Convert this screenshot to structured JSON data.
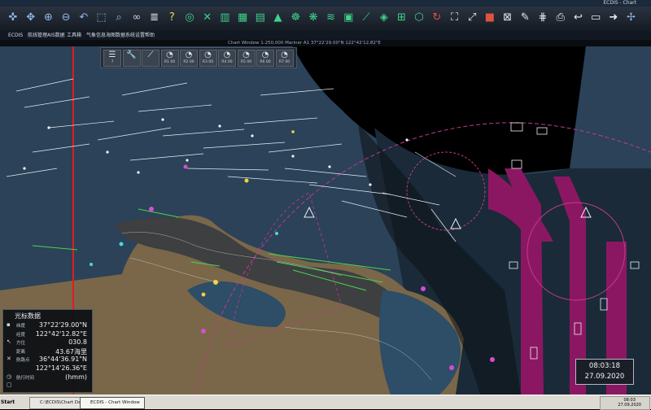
{
  "window": {
    "title": "ECDIS - Chart"
  },
  "toolbar": {
    "buttons": [
      {
        "name": "cursor-tool-button",
        "icon": "crosshair-icon",
        "glyph": "✜",
        "color": "#8fb7e6"
      },
      {
        "name": "pan-tool-button",
        "icon": "move-icon",
        "glyph": "✥",
        "color": "#8fb7e6"
      },
      {
        "name": "zoom-in-button",
        "icon": "zoom-in-icon",
        "glyph": "⊕",
        "color": "#8fb7e6"
      },
      {
        "name": "zoom-out-button",
        "icon": "zoom-out-icon",
        "glyph": "⊖",
        "color": "#8fb7e6"
      },
      {
        "name": "undo-view-button",
        "icon": "undo-icon",
        "glyph": "↶",
        "color": "#8fb7e6"
      },
      {
        "name": "zoom-area-button",
        "icon": "zoom-area-icon",
        "glyph": "⬚",
        "color": "#8fb7e6"
      },
      {
        "name": "search-button",
        "icon": "search-icon",
        "glyph": "⌕",
        "color": "#8fb7e6"
      },
      {
        "name": "binoculars-button",
        "icon": "binoculars-icon",
        "glyph": "∞",
        "color": "#c9d3de"
      },
      {
        "name": "layers-button",
        "icon": "layers-icon",
        "glyph": "≣",
        "color": "#e6e9ed"
      },
      {
        "name": "help-button",
        "icon": "help-icon",
        "glyph": "?",
        "color": "#f3d34a"
      },
      {
        "name": "target-button",
        "icon": "target-icon",
        "glyph": "◎",
        "color": "#3fd18a"
      },
      {
        "name": "tools-button",
        "icon": "tools-icon",
        "glyph": "✕",
        "color": "#3fd18a"
      },
      {
        "name": "route-button",
        "icon": "route-icon",
        "glyph": "▥",
        "color": "#3fd18a"
      },
      {
        "name": "route-table-button",
        "icon": "table-icon",
        "glyph": "▦",
        "color": "#3fd18a"
      },
      {
        "name": "chart-button",
        "icon": "chart-icon",
        "glyph": "▤",
        "color": "#3fd18a"
      },
      {
        "name": "ais-button",
        "icon": "ship-icon",
        "glyph": "▲",
        "color": "#3fd18a"
      },
      {
        "name": "radar-button",
        "icon": "radar-icon",
        "glyph": "☸",
        "color": "#3fd18a"
      },
      {
        "name": "weather-button",
        "icon": "weather-icon",
        "glyph": "❋",
        "color": "#3fd18a"
      },
      {
        "name": "tide-button",
        "icon": "tide-icon",
        "glyph": "≋",
        "color": "#3fd18a"
      },
      {
        "name": "log-button",
        "icon": "log-icon",
        "glyph": "▣",
        "color": "#3fd18a"
      },
      {
        "name": "measure-button",
        "icon": "measure-icon",
        "glyph": "⟋",
        "color": "#3fd18a"
      },
      {
        "name": "mark-button",
        "icon": "mark-icon",
        "glyph": "◈",
        "color": "#3fd18a"
      },
      {
        "name": "grid-button",
        "icon": "grid-icon",
        "glyph": "⊞",
        "color": "#3fd18a"
      },
      {
        "name": "alarm-area-button",
        "icon": "area-icon",
        "glyph": "⬡",
        "color": "#3fd18a"
      },
      {
        "name": "refresh-button",
        "icon": "refresh-icon",
        "glyph": "↻",
        "color": "#e0533f"
      },
      {
        "name": "select-area-button",
        "icon": "select-icon",
        "glyph": "⛶",
        "color": "#e6e9ed"
      },
      {
        "name": "fit-button",
        "icon": "fit-icon",
        "glyph": "⤢",
        "color": "#e6e9ed"
      },
      {
        "name": "stop-button",
        "icon": "stop-icon",
        "glyph": "■",
        "color": "#e0533f"
      },
      {
        "name": "delete-button",
        "icon": "delete-icon",
        "glyph": "⊠",
        "color": "#e6e9ed"
      },
      {
        "name": "pen-button",
        "icon": "pen-icon",
        "glyph": "✎",
        "color": "#e6e9ed"
      },
      {
        "name": "net-button",
        "icon": "net-icon",
        "glyph": "⋕",
        "color": "#e6e9ed"
      },
      {
        "name": "print-button",
        "icon": "print-icon",
        "glyph": "⎙",
        "color": "#e6e9ed"
      },
      {
        "name": "back-button",
        "icon": "back-icon",
        "glyph": "↩",
        "color": "#e6e9ed"
      },
      {
        "name": "window-button",
        "icon": "window-icon",
        "glyph": "▭",
        "color": "#e6e9ed"
      },
      {
        "name": "exit-button",
        "icon": "exit-icon",
        "glyph": "➜",
        "color": "#e6e9ed"
      },
      {
        "name": "compass-button",
        "icon": "compass-icon",
        "glyph": "✢",
        "color": "#8fb7e6"
      }
    ]
  },
  "menu": {
    "items": [
      "ECDIS",
      "航线管理",
      "AIS数据",
      "工具箱",
      "气象信息",
      "海图数据",
      "系统设置",
      "帮助"
    ]
  },
  "infobar": {
    "text": "Chart Window  1:250,000  Mariner  A1  37°22'29.00\"N 122°42'12.82\"E"
  },
  "layer_toolbar": {
    "buttons": [
      {
        "name": "layers-stack-button",
        "icon": "layers-icon",
        "glyph": "☰",
        "sub": "7"
      },
      {
        "name": "settings-wrench-button",
        "icon": "wrench-icon",
        "glyph": "🔧",
        "sub": ""
      },
      {
        "name": "draw-line-button",
        "icon": "line-icon",
        "glyph": "⟋",
        "sub": ""
      },
      {
        "name": "range-1-button",
        "icon": "range-icon",
        "glyph": "◔",
        "sub": "R1 00"
      },
      {
        "name": "range-2-button",
        "icon": "range-icon",
        "glyph": "◔",
        "sub": "R2 00"
      },
      {
        "name": "range-3-button",
        "icon": "range-icon",
        "glyph": "◔",
        "sub": "R3 00"
      },
      {
        "name": "range-4-button",
        "icon": "range-icon",
        "glyph": "◔",
        "sub": "R4 00"
      },
      {
        "name": "range-5-button",
        "icon": "range-icon",
        "glyph": "◔",
        "sub": "R5 00"
      },
      {
        "name": "range-6-button",
        "icon": "range-icon",
        "glyph": "◔",
        "sub": "R6 00"
      },
      {
        "name": "range-7-button",
        "icon": "range-icon",
        "glyph": "◔",
        "sub": "R7 00"
      }
    ]
  },
  "cursor_panel": {
    "title": "光标数据",
    "rows": [
      {
        "icon": "position-icon",
        "glyph": "▪",
        "label": "纬度",
        "value": "37°22'29.00\"N"
      },
      {
        "icon": "position-icon",
        "glyph": " ",
        "label": "经度",
        "value": "122°42'12.82\"E"
      },
      {
        "icon": "bearing-icon",
        "glyph": "↖",
        "label": "方位",
        "value": "030.8"
      },
      {
        "icon": "range-icon",
        "glyph": " ",
        "label": "距离",
        "value": "43.67海里"
      },
      {
        "icon": "waypoint-icon",
        "glyph": "✕",
        "label": "航路点",
        "value": "36°44'36.91\"N"
      },
      {
        "icon": "waypoint-icon",
        "glyph": " ",
        "label": "",
        "value": "122°14'26.36\"E"
      },
      {
        "icon": "time-icon",
        "glyph": "◷",
        "label": "航行时间",
        "value": "(hmm)"
      },
      {
        "icon": "mode-icon",
        "glyph": "▢",
        "label": "",
        "value": ""
      }
    ]
  },
  "clock": {
    "time": "08:03:18",
    "date": "27.09.2020"
  },
  "taskbar": {
    "start": "Start",
    "tasks": [
      {
        "label": "C:\\ECDIS\\Chart Data",
        "active": false
      },
      {
        "label": "ECDIS - Chart Window",
        "active": true
      }
    ],
    "tray_time": "08:03",
    "tray_date": "27.09.2020"
  },
  "colors": {
    "sea_deep": "#1d2f3f",
    "sea_shallow": "#2d4a62",
    "land": "#7a6749",
    "restricted": "#8b1762",
    "traffic": "#e9eef5",
    "ownship_line": "#e01e1e"
  }
}
